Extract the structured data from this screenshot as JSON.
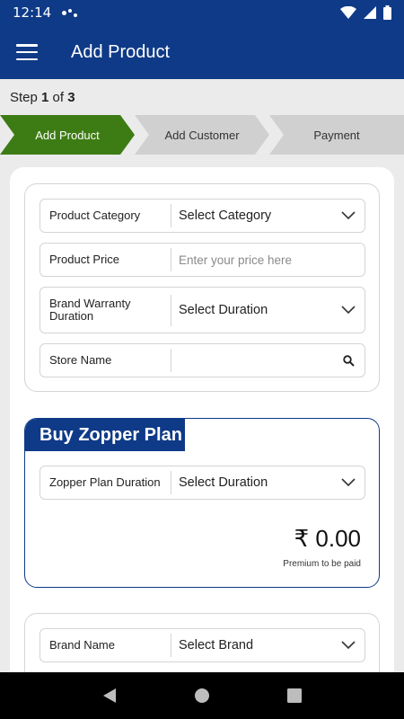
{
  "status": {
    "time": "12:14"
  },
  "appbar": {
    "title": "Add Product"
  },
  "stepper": {
    "prefix": "Step ",
    "current": "1",
    "of": " of ",
    "total": "3",
    "steps": [
      "Add Product",
      "Add Customer",
      "Payment"
    ]
  },
  "product_form": {
    "category_label": "Product Category",
    "category_value": "Select Category",
    "price_label": "Product Price",
    "price_placeholder": "Enter your price here",
    "warranty_label": "Brand Warranty Duration",
    "warranty_value": "Select Duration",
    "store_label": "Store Name",
    "store_value": ""
  },
  "zopper_plan": {
    "title": "Buy Zopper Plan",
    "duration_label": "Zopper Plan Duration",
    "duration_value": "Select Duration",
    "price": "₹ 0.00",
    "price_caption": "Premium to be paid"
  },
  "brand_form": {
    "brand_label": "Brand Name",
    "brand_value": "Select Brand"
  },
  "colors": {
    "primary": "#0f3a87",
    "active_step": "#3d7c14",
    "inactive_step": "#d0d0d0"
  }
}
